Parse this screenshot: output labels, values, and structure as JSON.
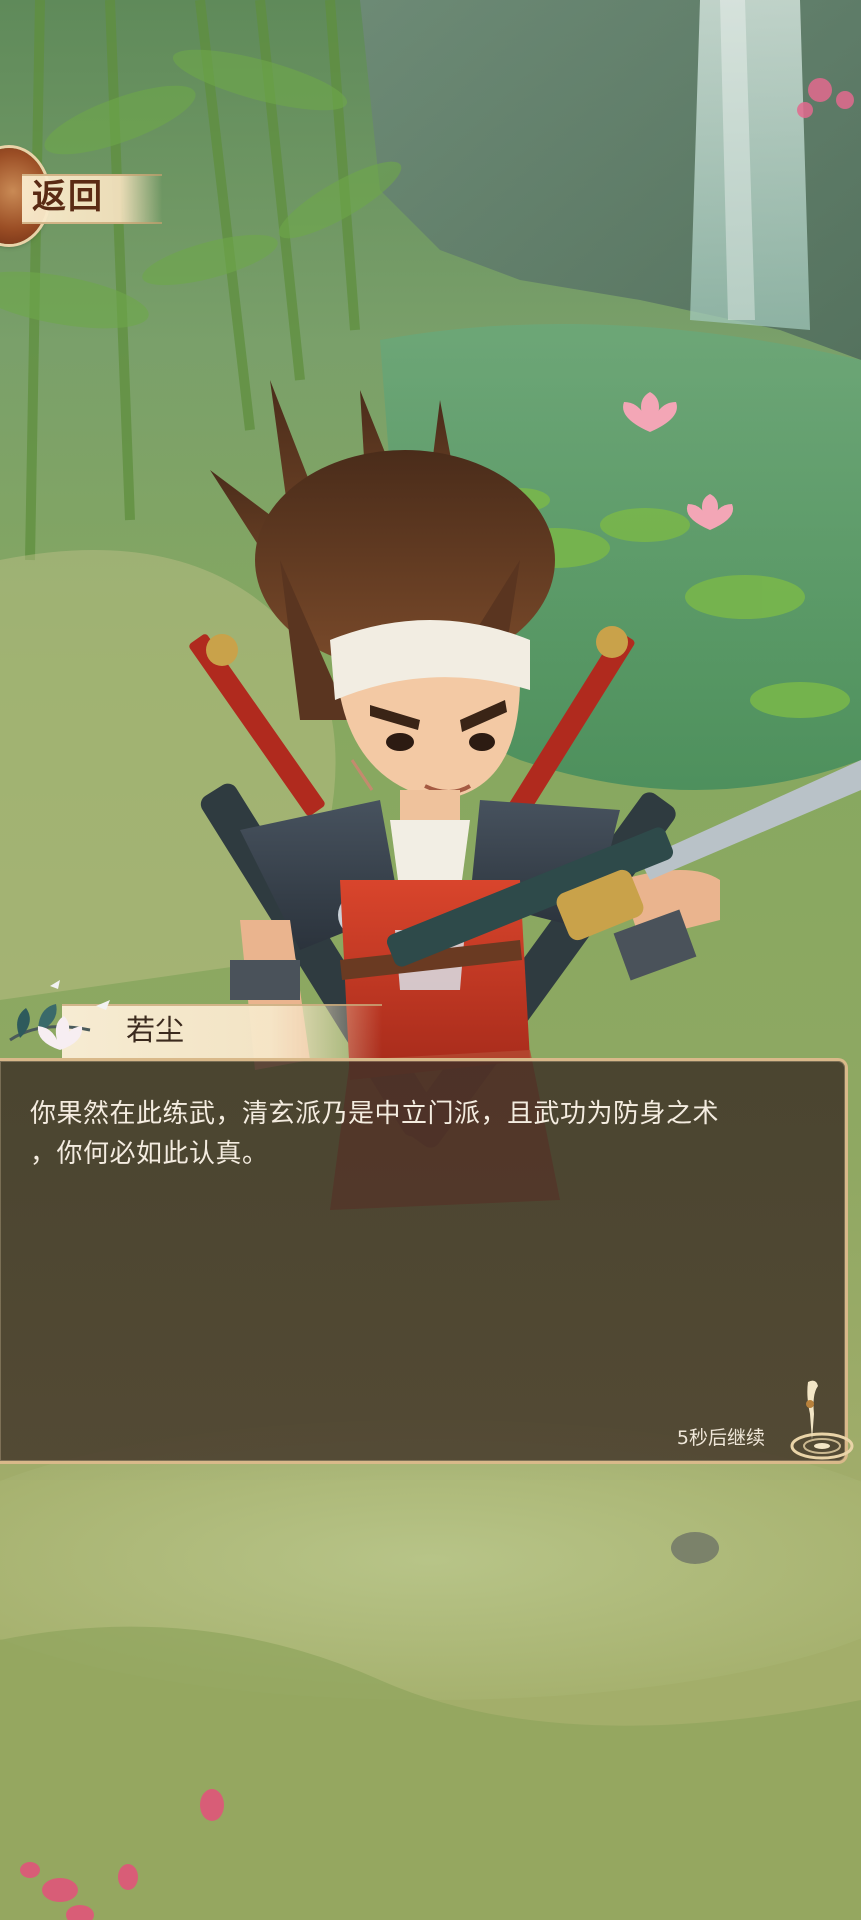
{
  "header": {
    "back_label": "返回"
  },
  "dialog": {
    "speaker": "若尘",
    "line1": "你果然在此练武，清玄派乃是中立门派，且武功为防身之术",
    "line2": "，你何必如此认真。",
    "continue_hint": "5秒后继续"
  },
  "icons": {
    "back": "back-emblem-icon",
    "continue": "quill-ink-icon",
    "flower": "lotus-branch-icon"
  },
  "colors": {
    "dialog_border": "#d9b98a",
    "dialog_bg": "#3a2c24",
    "dialog_text": "#f4ece0",
    "name_text": "#3b2a1e",
    "back_text": "#5a2a14"
  }
}
